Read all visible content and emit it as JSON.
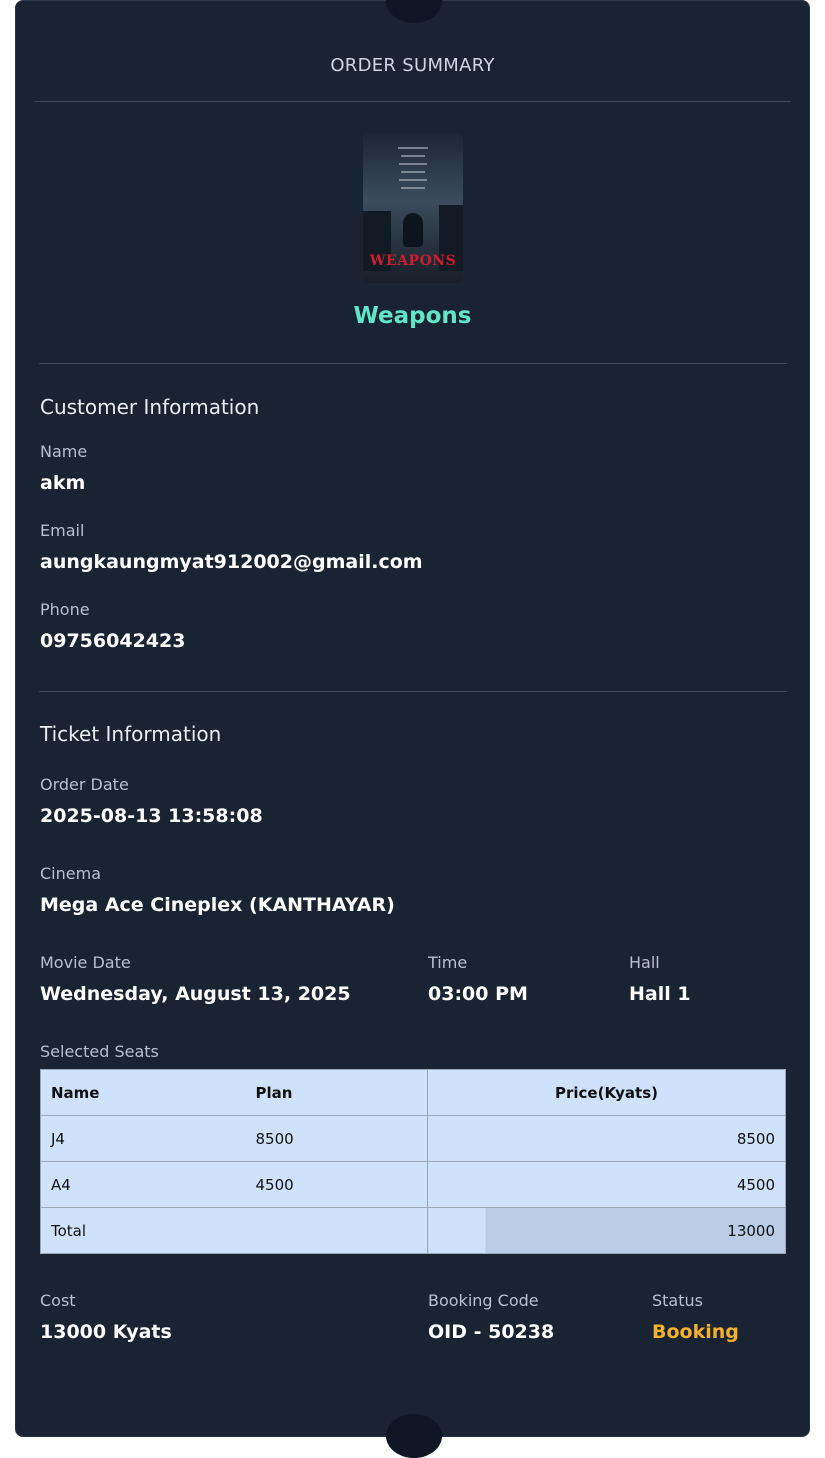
{
  "header": {
    "title": "ORDER SUMMARY"
  },
  "movie": {
    "title": "Weapons",
    "poster_title": "WEAPONS"
  },
  "customer": {
    "section_title": "Customer Information",
    "name_label": "Name",
    "name": "akm",
    "email_label": "Email",
    "email": "aungkaungmyat912002@gmail.com",
    "phone_label": "Phone",
    "phone": "09756042423"
  },
  "ticket": {
    "section_title": "Ticket Information",
    "order_date_label": "Order Date",
    "order_date": "2025-08-13 13:58:08",
    "cinema_label": "Cinema",
    "cinema": "Mega Ace Cineplex (KANTHAYAR)",
    "movie_date_label": "Movie Date",
    "movie_date": "Wednesday, August 13, 2025",
    "time_label": "Time",
    "time": "03:00 PM",
    "hall_label": "Hall",
    "hall": "Hall 1",
    "seats_label": "Selected Seats",
    "seats_table": {
      "headers": [
        "Name",
        "Plan",
        "Price(Kyats)"
      ],
      "rows": [
        {
          "name": "J4",
          "plan": "8500",
          "price": "8500"
        },
        {
          "name": "A4",
          "plan": "4500",
          "price": "4500"
        }
      ],
      "total_label": "Total",
      "total": "13000"
    }
  },
  "summary": {
    "cost_label": "Cost",
    "cost": "13000 Kyats",
    "booking_code_label": "Booking Code",
    "booking_code": "OID - 50238",
    "status_label": "Status",
    "status": "Booking",
    "status_color": "#f6b12a"
  },
  "colors": {
    "background": "#1a2332",
    "accent": "#5ee8c8",
    "table": "#cfe2fb"
  }
}
